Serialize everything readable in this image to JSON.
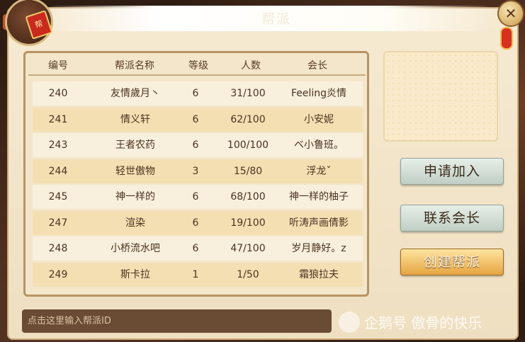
{
  "window": {
    "title": "帮派"
  },
  "guild_list": {
    "headers": {
      "id": "编号",
      "name": "帮派名称",
      "level": "等级",
      "members": "人数",
      "leader": "会长"
    },
    "rows": [
      {
        "id": "240",
        "name": "友情歲月丶",
        "level": "6",
        "members": "31/100",
        "leader": "Feeling炎情"
      },
      {
        "id": "241",
        "name": "情义轩",
        "level": "6",
        "members": "62/100",
        "leader": "小安妮"
      },
      {
        "id": "243",
        "name": "王者农药",
        "level": "6",
        "members": "100/100",
        "leader": "ベ小鲁班。"
      },
      {
        "id": "244",
        "name": "轻世傲物",
        "level": "3",
        "members": "15/80",
        "leader": "浮龙ˇ"
      },
      {
        "id": "245",
        "name": "神一样的",
        "level": "6",
        "members": "68/100",
        "leader": "神一样的柚子"
      },
      {
        "id": "247",
        "name": "渲染",
        "level": "6",
        "members": "19/100",
        "leader": "听涛声画倩影"
      },
      {
        "id": "248",
        "name": "小桥流水吧",
        "level": "6",
        "members": "47/100",
        "leader": "岁月静好。z"
      },
      {
        "id": "249",
        "name": "斯卡拉",
        "level": "1",
        "members": "1/50",
        "leader": "霜狼拉夫"
      }
    ]
  },
  "actions": {
    "apply": "申请加入",
    "contact": "联系会长",
    "create": "创建帮派"
  },
  "search": {
    "placeholder": "点击这里输入帮派ID"
  },
  "watermark": {
    "text": "企鹅号 傲骨的快乐"
  },
  "icons": {
    "badge": "guild-tag-icon",
    "close": "close-icon",
    "watermark": "penguin-icon"
  },
  "colors": {
    "row_odd": "#f8efdc",
    "row_even": "#f4dfb3",
    "create_button": "#e4a33e",
    "gray_button": "#bfcdc4"
  }
}
